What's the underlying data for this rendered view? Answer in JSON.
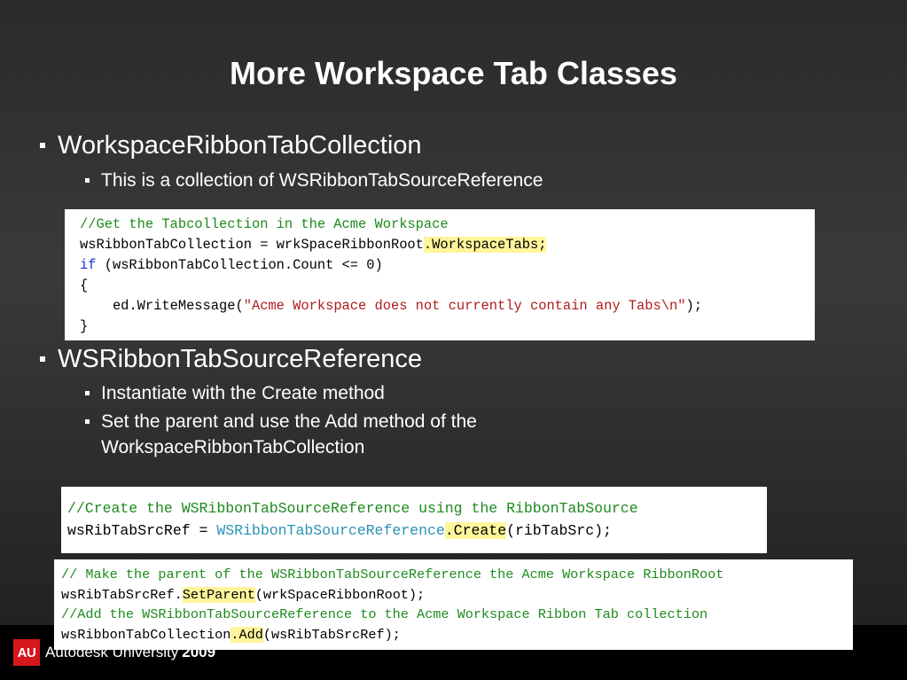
{
  "slide": {
    "title": "More Workspace Tab Classes"
  },
  "bullets": {
    "b1": "WorkspaceRibbonTabCollection",
    "b1_sub1": "This is a collection of WSRibbonTabSourceReference",
    "b2": "WSRibbonTabSourceReference",
    "b2_sub1": "Instantiate with the Create method",
    "b2_sub2_line1": "Set the parent and use the Add method of the",
    "b2_sub2_line2": "WorkspaceRibbonTabCollection"
  },
  "code1": {
    "l1": "//Get the Tabcollection in the Acme Workspace",
    "l2a": "wsRibbonTabCollection = wrkSpaceRibbonRoot",
    "l2b": ".WorkspaceTabs;",
    "l3a": "if",
    "l3b": " (wsRibbonTabCollection.Count <= 0)",
    "l4": "{",
    "l5a": "    ed.WriteMessage(",
    "l5b": "\"Acme Workspace does not currently contain any Tabs\\n\"",
    "l5c": ");",
    "l6": "}"
  },
  "code2": {
    "l1": "//Create the WSRibbonTabSourceReference using the RibbonTabSource",
    "l2a": "wsRibTabSrcRef = ",
    "l2b": "WSRibbonTabSourceReference",
    "l2c": ".Create",
    "l2d": "(ribTabSrc);"
  },
  "code3": {
    "l1": "// Make the parent of the WSRibbonTabSourceReference the Acme Workspace RibbonRoot",
    "l2a": "wsRibTabSrcRef.",
    "l2b": "SetParent",
    "l2c": "(wrkSpaceRibbonRoot);",
    "l3": "//Add the WSRibbonTabSourceReference to the Acme Workspace Ribbon Tab collection",
    "l4a": "wsRibbonTabCollection",
    "l4b": ".Add",
    "l4c": "(wsRibTabSrcRef);"
  },
  "footer": {
    "logo_text": "AU",
    "brand": "Autodesk University",
    "year": "2009",
    "logo_color": "#d6171c"
  }
}
